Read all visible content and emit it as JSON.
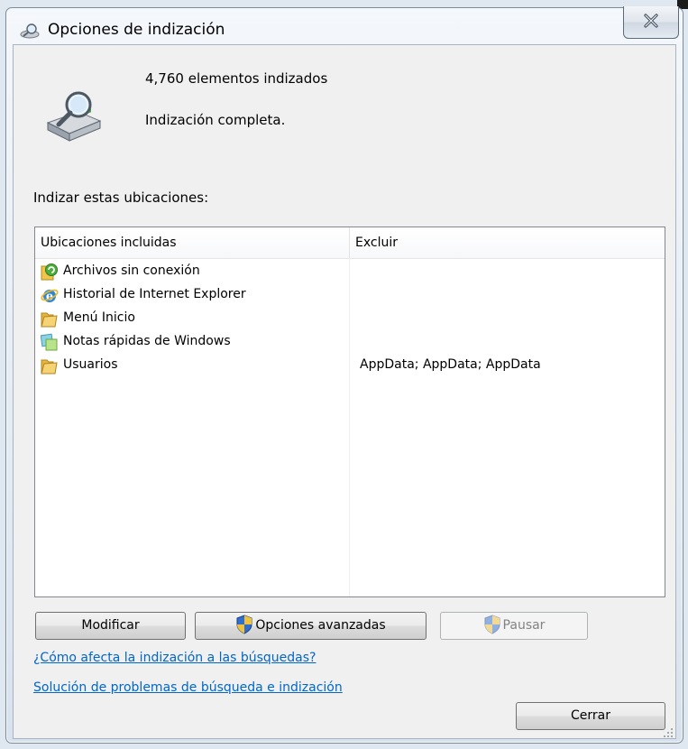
{
  "window": {
    "title": "Opciones de indización",
    "close_icon": "close-icon"
  },
  "status": {
    "count_text": "4,760 elementos indizados",
    "state_text": "Indización completa.",
    "icon": "indexing-drive-icon"
  },
  "section_label": "Indizar estas ubicaciones:",
  "list": {
    "columns": [
      "Ubicaciones incluidas",
      "Excluir"
    ],
    "rows": [
      {
        "name": "Archivos sin conexión",
        "exclude": "",
        "icon": "offline-files-icon"
      },
      {
        "name": "Historial de Internet Explorer",
        "exclude": "",
        "icon": "internet-explorer-icon"
      },
      {
        "name": "Menú Inicio",
        "exclude": "",
        "icon": "folder-icon"
      },
      {
        "name": "Notas rápidas de Windows",
        "exclude": "",
        "icon": "sticky-notes-icon"
      },
      {
        "name": "Usuarios",
        "exclude": "AppData; AppData; AppData",
        "icon": "folder-icon"
      }
    ]
  },
  "buttons": {
    "modify": "Modificar",
    "advanced": "Opciones avanzadas",
    "pause": "Pausar",
    "close": "Cerrar"
  },
  "links": {
    "how_affects": "¿Cómo afecta la indización a las búsquedas?",
    "troubleshoot": "Solución de problemas de búsqueda e indización"
  },
  "colors": {
    "link": "#0066cc",
    "window_bg": "#f0f0f0"
  }
}
